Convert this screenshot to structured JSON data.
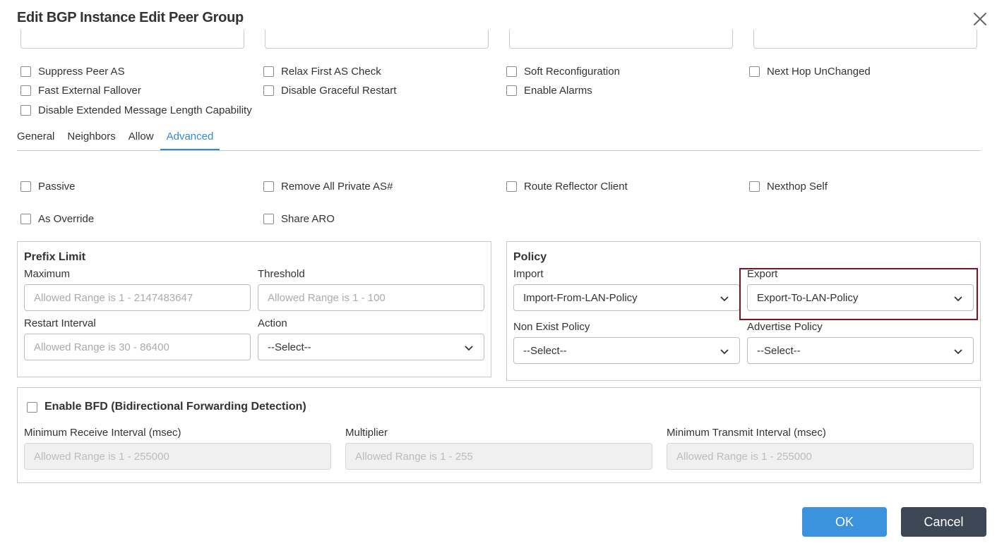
{
  "dialog": {
    "title": "Edit BGP Instance Edit Peer Group"
  },
  "top_checkboxes": [
    {
      "label": "Suppress Peer AS",
      "checked": false
    },
    {
      "label": "Relax First AS Check",
      "checked": false
    },
    {
      "label": "Soft Reconfiguration",
      "checked": false
    },
    {
      "label": "Next Hop UnChanged",
      "checked": false
    },
    {
      "label": "Fast External Fallover",
      "checked": false
    },
    {
      "label": "Disable Graceful Restart",
      "checked": false
    },
    {
      "label": "Enable Alarms",
      "checked": false
    },
    {
      "label": "Disable Extended Message Length Capability",
      "checked": false
    }
  ],
  "tabs": [
    {
      "label": "General",
      "active": false
    },
    {
      "label": "Neighbors",
      "active": false
    },
    {
      "label": "Allow",
      "active": false
    },
    {
      "label": "Advanced",
      "active": true
    }
  ],
  "advanced_checkboxes": [
    {
      "label": "Passive",
      "checked": false
    },
    {
      "label": "Remove All Private AS#",
      "checked": false
    },
    {
      "label": "Route Reflector Client",
      "checked": false
    },
    {
      "label": "Nexthop Self",
      "checked": false
    },
    {
      "label": "As Override",
      "checked": false
    },
    {
      "label": "Share ARO",
      "checked": false
    }
  ],
  "prefix_limit": {
    "title": "Prefix Limit",
    "maximum_label": "Maximum",
    "maximum_placeholder": "Allowed Range is 1 - 2147483647",
    "threshold_label": "Threshold",
    "threshold_placeholder": "Allowed Range is 1 - 100",
    "restart_label": "Restart Interval",
    "restart_placeholder": "Allowed Range is 30 - 86400",
    "action_label": "Action",
    "action_value": "--Select--"
  },
  "policy": {
    "title": "Policy",
    "import_label": "Import",
    "import_value": "Import-From-LAN-Policy",
    "export_label": "Export",
    "export_value": "Export-To-LAN-Policy",
    "non_exist_label": "Non Exist Policy",
    "non_exist_value": "--Select--",
    "advertise_label": "Advertise Policy",
    "advertise_value": "--Select--"
  },
  "bfd": {
    "title": "Enable BFD (Bidirectional Forwarding Detection)",
    "checked": false,
    "min_receive_label": "Minimum Receive Interval (msec)",
    "min_receive_placeholder": "Allowed Range is 1 - 255000",
    "multiplier_label": "Multiplier",
    "multiplier_placeholder": "Allowed Range is 1 - 255",
    "min_transmit_label": "Minimum Transmit Interval (msec)",
    "min_transmit_placeholder": "Allowed Range is 1 - 255000"
  },
  "buttons": {
    "ok": "OK",
    "cancel": "Cancel"
  },
  "colors": {
    "accent": "#3b93dd",
    "tab_active": "#2f8ad8",
    "cancel": "#3b4754",
    "highlight": "#7a1426"
  }
}
